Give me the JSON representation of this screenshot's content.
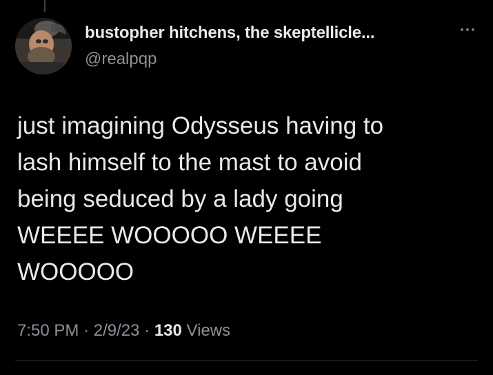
{
  "author": {
    "display_name": "bustopher hitchens, the skeptellicle...",
    "handle": "@realpqp"
  },
  "tweet": {
    "lines": [
      "just imagining Odysseus having to",
      "lash himself to the mast to avoid",
      "being seduced by a lady going",
      "WEEEE WOOOOO WEEEE",
      "WOOOOO"
    ],
    "time": "7:50 PM",
    "separator": "·",
    "date": "2/9/23",
    "views_count": "130",
    "views_label": "Views"
  },
  "icons": {
    "more": "more-options-icon"
  },
  "colors": {
    "background": "#000000",
    "primary_text": "#e7e9ea",
    "secondary_text": "#8b9197",
    "divider": "#2f3336"
  }
}
